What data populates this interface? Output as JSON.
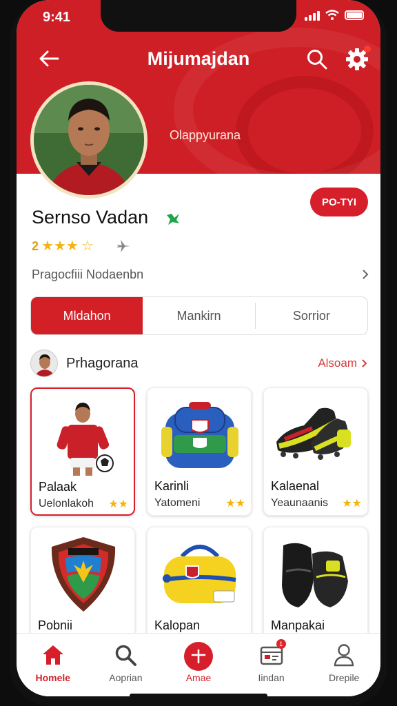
{
  "status": {
    "time": "9:41"
  },
  "header": {
    "title": "Mijumajdan",
    "subtitle": "Olappyurana"
  },
  "profile": {
    "name": "Sernso Vadan",
    "rating_number": "2",
    "rating_stars": "★★★",
    "rating_extra": "☆",
    "description": "Pragocfiii Nodaenbn",
    "follow_label": "PO-TYI"
  },
  "segments": {
    "items": [
      "Mldahon",
      "Mankirn",
      "Sorrior"
    ],
    "active_index": 0
  },
  "section": {
    "title": "Prhagorana",
    "see_all": "Alsoam"
  },
  "cards": [
    {
      "title": "Palaak",
      "subtitle": "Uelonlakoh",
      "stars": "★★",
      "icon": "player-photo-icon"
    },
    {
      "title": "Karinli",
      "subtitle": "Yatomeni",
      "stars": "★★",
      "icon": "backpack-icon"
    },
    {
      "title": "Kalaenal",
      "subtitle": "Yeaunaanis",
      "stars": "★★",
      "icon": "football-boots-icon"
    },
    {
      "title": "Pobnii",
      "subtitle": "",
      "stars": "",
      "icon": "club-crest-icon"
    },
    {
      "title": "Kalopan",
      "subtitle": "",
      "stars": "",
      "icon": "duffel-bag-icon"
    },
    {
      "title": "Manpakai",
      "subtitle": "",
      "stars": "★",
      "icon": "black-boots-icon"
    }
  ],
  "tabbar": {
    "items": [
      {
        "label": "Homele",
        "icon": "home-icon"
      },
      {
        "label": "Aoprian",
        "icon": "search-icon"
      },
      {
        "label": "Amae",
        "icon": "add-icon"
      },
      {
        "label": "Iindan",
        "icon": "inbox-icon"
      },
      {
        "label": "Drepile",
        "icon": "profile-icon"
      }
    ],
    "badge": "1",
    "active_index": 0
  },
  "colors": {
    "brand_red": "#cf1f26",
    "star_gold": "#f5b30b",
    "link_red": "#d93b3b"
  }
}
